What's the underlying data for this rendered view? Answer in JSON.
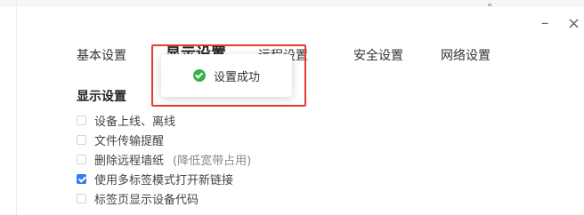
{
  "window": {
    "minimize_icon": "minimize-icon",
    "close_icon": "close-icon",
    "minimize_glyph": "–",
    "close_glyph": "×"
  },
  "tabs": [
    {
      "label": "基本设置",
      "active": false
    },
    {
      "label": "显示设置",
      "active": true
    },
    {
      "label": "远程设置",
      "active": false
    },
    {
      "label": "安全设置",
      "active": false
    },
    {
      "label": "网络设置",
      "active": false
    }
  ],
  "section": {
    "title": "显示设置"
  },
  "options": [
    {
      "label": "设备上线、离线",
      "checked": false,
      "note": ""
    },
    {
      "label": "文件传输提醒",
      "checked": false,
      "note": ""
    },
    {
      "label": "删除远程墙纸",
      "checked": false,
      "note": "(降低宽带占用)"
    },
    {
      "label": "使用多标签模式打开新链接",
      "checked": true,
      "note": ""
    },
    {
      "label": "标签页显示设备代码",
      "checked": false,
      "note": ""
    }
  ],
  "toast": {
    "message": "设置成功",
    "icon": "success-check-icon",
    "highlight_color": "#e53935",
    "icon_color": "#35b24a"
  },
  "colors": {
    "checkbox_checked": "#2f7df6"
  }
}
